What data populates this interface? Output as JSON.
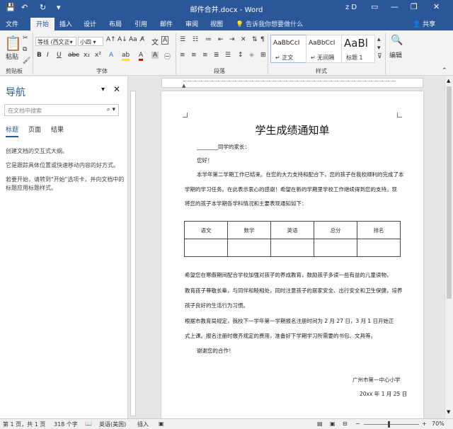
{
  "window": {
    "title": "邮件合并.docx - Word",
    "user": "z D",
    "quick_access": {
      "save": "💾",
      "undo": "↶",
      "redo": "↻",
      "customize": "▾"
    },
    "controls": {
      "ribbon_options": "▭",
      "minimize": "—",
      "restore": "❐",
      "close": "✕"
    }
  },
  "tabs": [
    "文件",
    "开始",
    "插入",
    "设计",
    "布局",
    "引用",
    "邮件",
    "审阅",
    "视图"
  ],
  "active_tab": "开始",
  "tell_me": "告诉我你想要做什么",
  "share": "共享",
  "ribbon": {
    "clipboard": {
      "label": "剪贴板",
      "paste": "粘贴"
    },
    "font": {
      "label": "字体",
      "font_name": "等线 (西文正▾",
      "font_size": "小四 ▾"
    },
    "paragraph": {
      "label": "段落"
    },
    "styles": {
      "label": "样式",
      "items": [
        {
          "sample": "AaBbCcI",
          "name": "↵ 正文"
        },
        {
          "sample": "AaBbCcI",
          "name": "↵ 无间隔"
        },
        {
          "sample": "AaBl",
          "name": "标题 1"
        }
      ]
    },
    "editing": {
      "label": "编辑"
    }
  },
  "nav": {
    "title": "导航",
    "search_placeholder": "在文档中搜索",
    "tabs": [
      "标题",
      "页面",
      "结果"
    ],
    "active_tab": "标题",
    "text1": "创建文档的交互式大纲。",
    "text2": "它是跟踪具体位置或快速移动内容的好方式。",
    "text3": "若要开始，请转到\"开始\"选项卡，并向文档中的标题应用标题样式。"
  },
  "document": {
    "title": "学生成绩通知单",
    "salutation": "________同学的家长：",
    "greeting": "您好！",
    "p1_line1": "本学年第二学期工作已结束。在您的大力支持和配合下，您的孩子在我校顺利的完成了本",
    "p1_line2": "学期的学习任务。在此表示衷心的感谢！希望在新的学期里学校工作继续得到您的支持。现",
    "p1_line3": "将您的孩子本学期各学科情况和主要表现通知如下：",
    "table_headers": [
      "语文",
      "数学",
      "英语",
      "总分",
      "排名"
    ],
    "p2_line1": "希望您在寒假期间配合学校加强对孩子的养成教育，鼓励孩子多读一些有益的儿童读物，",
    "p2_line2": "教育孩子尊敬长辈，与同伴和睦相处，同时注意孩子的居家安全、出行安全和卫生保健，培养",
    "p2_line3": "孩子良好的生活行为习惯。",
    "p3_line1": "根据市教育局规定，我校下一学年第一学期报名注册时间为 2 月 27 日，3 月 1 日开始正",
    "p3_line2": "式上课。报名注册时缴齐规定的费用，准备好下学期学习所需要的书包、文具等。",
    "thanks": "谢谢您的合作！",
    "school": "广州市第一中心小学",
    "date": "20xx 年 1 月 25 日"
  },
  "status": {
    "page": "第 1 页，共 1 页",
    "words": "318 个字",
    "lang": "英语(美国)",
    "mode": "插入",
    "zoom": "70%"
  },
  "colors": {
    "accent": "#2b579a"
  }
}
